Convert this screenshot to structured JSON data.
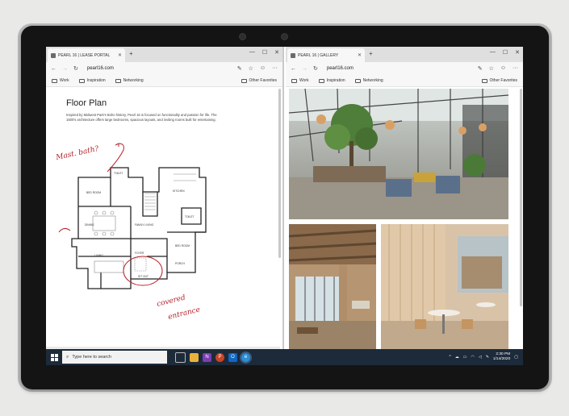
{
  "left_window": {
    "tab_title": "PEARL 16 | LEASE PORTAL",
    "url": "pearl16.com",
    "favorites": [
      "Work",
      "Inspiration",
      "Networking"
    ],
    "other_favorites": "Other Favorites",
    "page": {
      "title": "Floor Plan",
      "description": "Inspired by Midwest Park's Boho history, Pearl 16 is focused on functionality and passion for life. The 1500's architecture offers large bedrooms, spacious layouts, and inviting rooms built for entertaining.",
      "annotations": {
        "master_bath": "Mast. bath?",
        "covered_entrance_1": "covered",
        "covered_entrance_2": "entrance"
      },
      "room_labels": {
        "toilet_top": "TOILET",
        "bedroom_1": "BED ROOM",
        "kitchen": "KITCHEN",
        "toilet_right": "TOILET",
        "dining": "DINING",
        "family_living": "FAMILY LIVING",
        "bedroom_2": "BED ROOM",
        "living": "LIVING",
        "foyer": "FOYER",
        "sit_out": "SIT OUT",
        "porch": "PORCH"
      }
    }
  },
  "right_window": {
    "tab_title": "PEARL 16 | GALLERY",
    "url": "pearl16.com",
    "favorites": [
      "Work",
      "Inspiration",
      "Networking"
    ],
    "other_favorites": "Other Favorites"
  },
  "taskbar": {
    "search_placeholder": "Type here to search",
    "time": "2:30 PM",
    "date": "1/14/2020",
    "apps": [
      "file-explorer-icon",
      "onenote-icon",
      "powerpoint-icon",
      "outlook-icon",
      "edge-icon"
    ]
  },
  "colors": {
    "taskbar": "#1c2a3a",
    "ink_red": "#b5202a"
  }
}
